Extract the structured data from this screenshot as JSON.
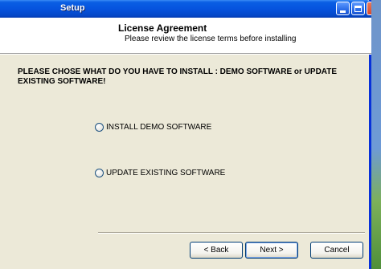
{
  "window": {
    "title": "Setup"
  },
  "header": {
    "title": "License Agreement",
    "subtitle": "Please review the license terms before installing"
  },
  "main": {
    "prompt": "PLEASE CHOSE WHAT DO YOU HAVE TO INSTALL : DEMO SOFTWARE or UPDATE EXISTING SOFTWARE!",
    "options": [
      {
        "label": "INSTALL DEMO SOFTWARE",
        "selected": false
      },
      {
        "label": "UPDATE EXISTING SOFTWARE",
        "selected": false
      }
    ]
  },
  "buttons": {
    "back": "< Back",
    "next": "Next >",
    "cancel": "Cancel"
  },
  "colors": {
    "titlebar": "#0653de",
    "dialog_bg": "#ece9d8",
    "header_bg": "#ffffff"
  }
}
